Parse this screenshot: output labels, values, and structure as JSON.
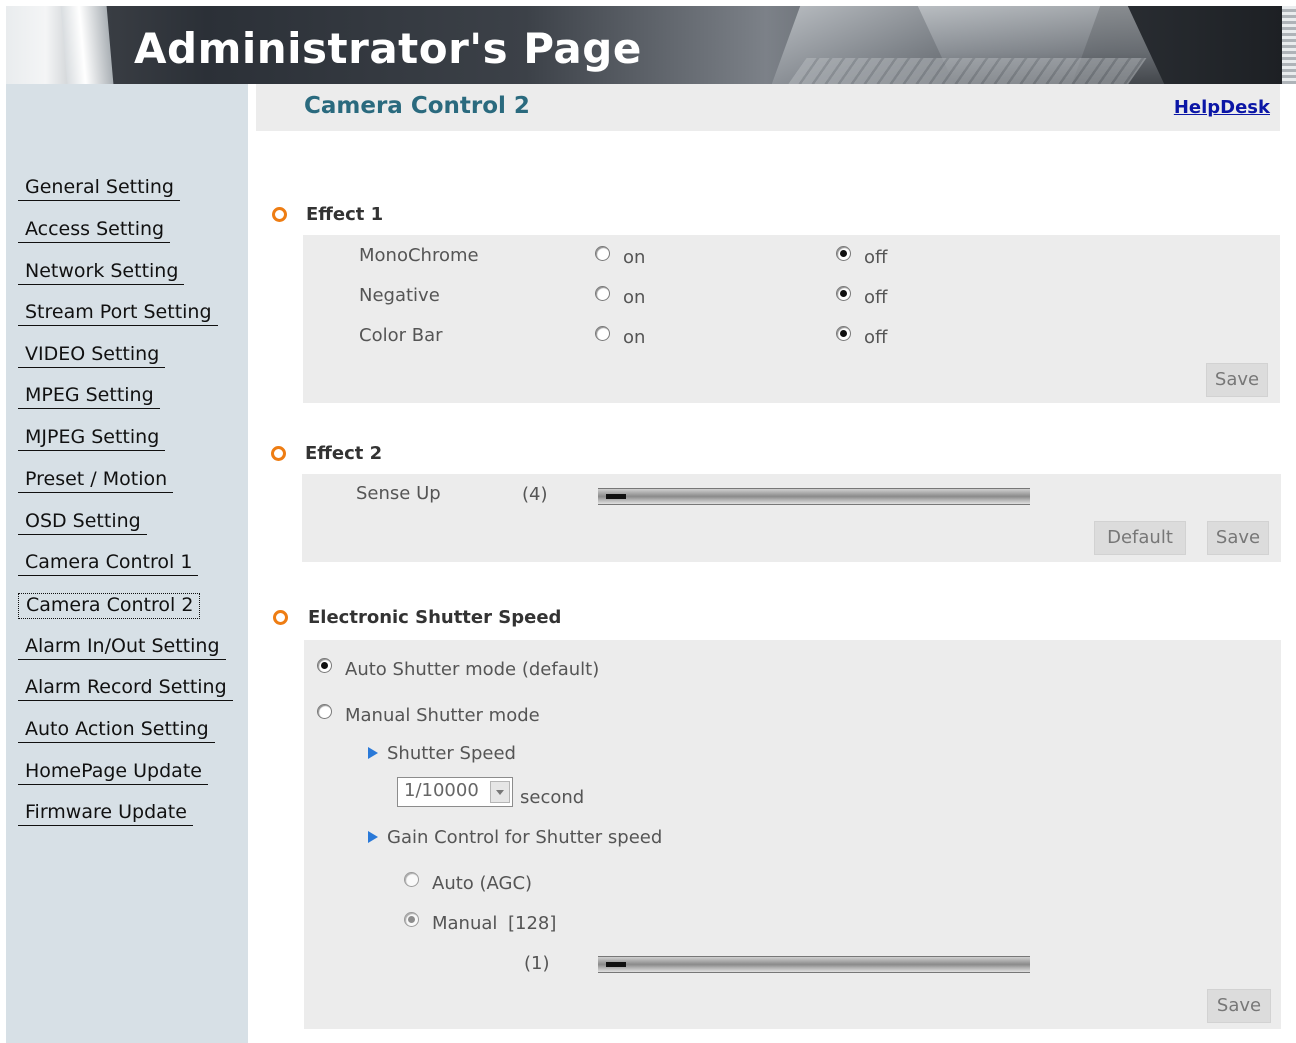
{
  "header": {
    "title": "Administrator's Page"
  },
  "sidebar": {
    "items": [
      {
        "label": "General Setting"
      },
      {
        "label": "Access Setting"
      },
      {
        "label": "Network Setting"
      },
      {
        "label": "Stream Port Setting"
      },
      {
        "label": "VIDEO Setting"
      },
      {
        "label": "MPEG Setting"
      },
      {
        "label": "MJPEG Setting"
      },
      {
        "label": "Preset / Motion"
      },
      {
        "label": "OSD Setting"
      },
      {
        "label": "Camera Control 1"
      },
      {
        "label": "Camera Control 2",
        "active": true
      },
      {
        "label": "Alarm In/Out Setting"
      },
      {
        "label": "Alarm Record Setting"
      },
      {
        "label": "Auto Action Setting"
      },
      {
        "label": "HomePage Update"
      },
      {
        "label": "Firmware Update"
      }
    ]
  },
  "main": {
    "page_title": "Camera Control 2",
    "helpdesk_label": "HelpDesk",
    "effect1": {
      "title": "Effect 1",
      "rows": [
        {
          "label": "MonoChrome",
          "on_label": "on",
          "off_label": "off",
          "selected": "off"
        },
        {
          "label": "Negative",
          "on_label": "on",
          "off_label": "off",
          "selected": "off"
        },
        {
          "label": "Color Bar",
          "on_label": "on",
          "off_label": "off",
          "selected": "off"
        }
      ],
      "save_label": "Save"
    },
    "effect2": {
      "title": "Effect 2",
      "sense_up_label": "Sense Up",
      "sense_up_value": "(4)",
      "sense_up_level": 0.02,
      "default_label": "Default",
      "save_label": "Save"
    },
    "shutter": {
      "title": "Electronic Shutter Speed",
      "auto_label": "Auto Shutter mode (default)",
      "manual_label": "Manual Shutter mode",
      "selected_mode": "auto",
      "shutter_speed_label": "Shutter Speed",
      "speed_value": "1/10000",
      "speed_unit": "second",
      "gain_label": "Gain Control for Shutter speed",
      "gain_auto_label": "Auto (AGC)",
      "gain_manual_label": "Manual",
      "gain_manual_value": "[128]",
      "gain_selected": "manual",
      "gain_slider_value": "(1)",
      "gain_level": 0.02,
      "save_label": "Save"
    }
  }
}
